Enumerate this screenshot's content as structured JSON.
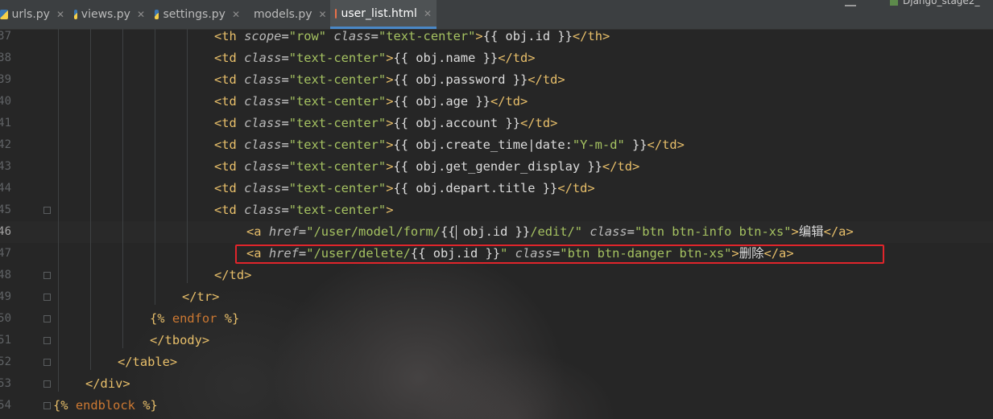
{
  "tabs": [
    {
      "label": "urls.py",
      "icon": "python-file-icon",
      "active": false
    },
    {
      "label": "views.py",
      "icon": "python-file-icon",
      "active": false
    },
    {
      "label": "settings.py",
      "icon": "python-file-icon",
      "active": false
    },
    {
      "label": "models.py",
      "icon": "python-file-icon",
      "active": false
    },
    {
      "label": "user_list.html",
      "icon": "html-file-icon",
      "active": true
    }
  ],
  "run_config": "Django_stage2_",
  "line_numbers": [
    "37",
    "38",
    "39",
    "40",
    "41",
    "42",
    "43",
    "44",
    "45",
    "46",
    "47",
    "48",
    "49",
    "50",
    "51",
    "52",
    "53",
    "54"
  ],
  "code": [
    [
      [
        "tagb",
        "<"
      ],
      [
        "tag",
        "th "
      ],
      [
        "attr",
        "scope"
      ],
      [
        "txt",
        "="
      ],
      [
        "attrv",
        "\"row\" "
      ],
      [
        "attr",
        "class"
      ],
      [
        "txt",
        "="
      ],
      [
        "attrv",
        "\"text-center\""
      ],
      [
        "tagb",
        ">"
      ],
      [
        "txt",
        "{{ obj.id }}"
      ],
      [
        "tagb",
        "</"
      ],
      [
        "tag",
        "th"
      ],
      [
        "tagb",
        ">"
      ]
    ],
    [
      [
        "tagb",
        "<"
      ],
      [
        "tag",
        "td "
      ],
      [
        "attr",
        "class"
      ],
      [
        "txt",
        "="
      ],
      [
        "attrv",
        "\"text-center\""
      ],
      [
        "tagb",
        ">"
      ],
      [
        "txt",
        "{{ obj.name }}"
      ],
      [
        "tagb",
        "</"
      ],
      [
        "tag",
        "td"
      ],
      [
        "tagb",
        ">"
      ]
    ],
    [
      [
        "tagb",
        "<"
      ],
      [
        "tag",
        "td "
      ],
      [
        "attr",
        "class"
      ],
      [
        "txt",
        "="
      ],
      [
        "attrv",
        "\"text-center\""
      ],
      [
        "tagb",
        ">"
      ],
      [
        "txt",
        "{{ obj.password }}"
      ],
      [
        "tagb",
        "</"
      ],
      [
        "tag",
        "td"
      ],
      [
        "tagb",
        ">"
      ]
    ],
    [
      [
        "tagb",
        "<"
      ],
      [
        "tag",
        "td "
      ],
      [
        "attr",
        "class"
      ],
      [
        "txt",
        "="
      ],
      [
        "attrv",
        "\"text-center\""
      ],
      [
        "tagb",
        ">"
      ],
      [
        "txt",
        "{{ obj.age }}"
      ],
      [
        "tagb",
        "</"
      ],
      [
        "tag",
        "td"
      ],
      [
        "tagb",
        ">"
      ]
    ],
    [
      [
        "tagb",
        "<"
      ],
      [
        "tag",
        "td "
      ],
      [
        "attr",
        "class"
      ],
      [
        "txt",
        "="
      ],
      [
        "attrv",
        "\"text-center\""
      ],
      [
        "tagb",
        ">"
      ],
      [
        "txt",
        "{{ obj.account }}"
      ],
      [
        "tagb",
        "</"
      ],
      [
        "tag",
        "td"
      ],
      [
        "tagb",
        ">"
      ]
    ],
    [
      [
        "tagb",
        "<"
      ],
      [
        "tag",
        "td "
      ],
      [
        "attr",
        "class"
      ],
      [
        "txt",
        "="
      ],
      [
        "attrv",
        "\"text-center\""
      ],
      [
        "tagb",
        ">"
      ],
      [
        "txt",
        "{{ obj.create_time|date:"
      ],
      [
        "attrv",
        "\"Y-m-d\""
      ],
      [
        "txt",
        " }}"
      ],
      [
        "tagb",
        "</"
      ],
      [
        "tag",
        "td"
      ],
      [
        "tagb",
        ">"
      ]
    ],
    [
      [
        "tagb",
        "<"
      ],
      [
        "tag",
        "td "
      ],
      [
        "attr",
        "class"
      ],
      [
        "txt",
        "="
      ],
      [
        "attrv",
        "\"text-center\""
      ],
      [
        "tagb",
        ">"
      ],
      [
        "txt",
        "{{ obj.get_gender_display }}"
      ],
      [
        "tagb",
        "</"
      ],
      [
        "tag",
        "td"
      ],
      [
        "tagb",
        ">"
      ]
    ],
    [
      [
        "tagb",
        "<"
      ],
      [
        "tag",
        "td "
      ],
      [
        "attr",
        "class"
      ],
      [
        "txt",
        "="
      ],
      [
        "attrv",
        "\"text-center\""
      ],
      [
        "tagb",
        ">"
      ],
      [
        "txt",
        "{{ obj.depart.title }}"
      ],
      [
        "tagb",
        "</"
      ],
      [
        "tag",
        "td"
      ],
      [
        "tagb",
        ">"
      ]
    ],
    [
      [
        "tagb",
        "<"
      ],
      [
        "tag",
        "td "
      ],
      [
        "attr",
        "class"
      ],
      [
        "txt",
        "="
      ],
      [
        "attrv",
        "\"text-center\""
      ],
      [
        "tagb",
        ">"
      ]
    ],
    [
      [
        "tagb",
        "<"
      ],
      [
        "tag",
        "a "
      ],
      [
        "attr",
        "href"
      ],
      [
        "txt",
        "="
      ],
      [
        "attrv",
        "\"/user/model/form/"
      ],
      [
        "txt",
        "{{ obj.id }}"
      ],
      [
        "attrv",
        "/edit/\" "
      ],
      [
        "attr",
        "class"
      ],
      [
        "txt",
        "="
      ],
      [
        "attrv",
        "\"btn btn-info btn-xs\""
      ],
      [
        "tagb",
        ">"
      ],
      [
        "txt",
        "编辑"
      ],
      [
        "tagb",
        "</"
      ],
      [
        "tag",
        "a"
      ],
      [
        "tagb",
        ">"
      ]
    ],
    [
      [
        "tagb",
        "<"
      ],
      [
        "tag",
        "a "
      ],
      [
        "attr",
        "href"
      ],
      [
        "txt",
        "="
      ],
      [
        "attrv",
        "\"/user/delete/"
      ],
      [
        "txt",
        "{{ obj.id }}"
      ],
      [
        "attrv",
        "\" "
      ],
      [
        "attr",
        "class"
      ],
      [
        "txt",
        "="
      ],
      [
        "attrv",
        "\"btn btn-danger btn-xs\""
      ],
      [
        "tagb",
        ">"
      ],
      [
        "txt",
        "删除"
      ],
      [
        "tagb",
        "</"
      ],
      [
        "tag",
        "a"
      ],
      [
        "tagb",
        ">"
      ]
    ],
    [
      [
        "tagb",
        "</"
      ],
      [
        "tag",
        "td"
      ],
      [
        "tagb",
        ">"
      ]
    ],
    [
      [
        "tagb",
        "</"
      ],
      [
        "tag",
        "tr"
      ],
      [
        "tagb",
        ">"
      ]
    ],
    [
      [
        "tmpl",
        "{% "
      ],
      [
        "kw",
        "endfor "
      ],
      [
        "tmpl",
        "%}"
      ]
    ],
    [
      [
        "tagb",
        "</"
      ],
      [
        "tag",
        "tbody"
      ],
      [
        "tagb",
        ">"
      ]
    ],
    [
      [
        "tagb",
        "</"
      ],
      [
        "tag",
        "table"
      ],
      [
        "tagb",
        ">"
      ]
    ],
    [
      [
        "tagb",
        "</"
      ],
      [
        "tag",
        "div"
      ],
      [
        "tagb",
        ">"
      ]
    ],
    [
      [
        "tmpl",
        "{% "
      ],
      [
        "kw",
        "endblock "
      ],
      [
        "tmpl",
        "%}"
      ]
    ]
  ]
}
